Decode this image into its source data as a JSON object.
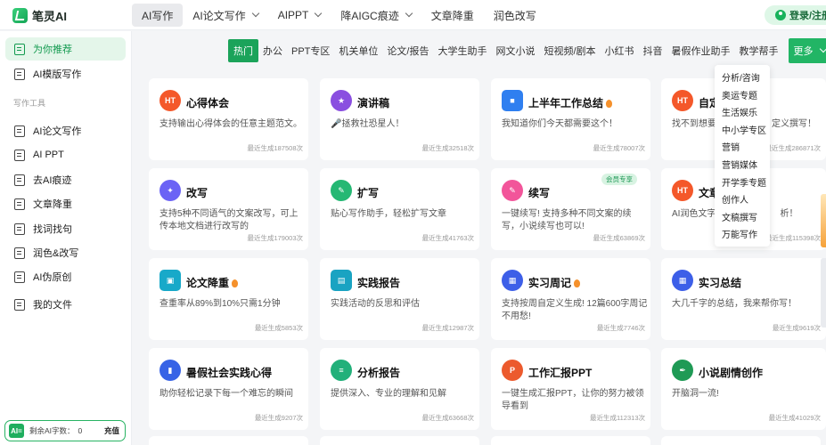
{
  "app": {
    "name": "笔灵AI"
  },
  "topnav": [
    {
      "label": "AI写作",
      "active": true,
      "dropdown": false
    },
    {
      "label": "AI论文写作",
      "active": false,
      "dropdown": true
    },
    {
      "label": "AIPPT",
      "active": false,
      "dropdown": true
    },
    {
      "label": "降AIGC痕迹",
      "active": false,
      "dropdown": true
    },
    {
      "label": "文章降重",
      "active": false,
      "dropdown": false
    },
    {
      "label": "润色改写",
      "active": false,
      "dropdown": false
    }
  ],
  "login": "登录/注册",
  "sidebar": {
    "items": [
      {
        "label": "为你推荐",
        "active": true
      },
      {
        "label": "AI模版写作",
        "active": false
      },
      {
        "label": "AI论文写作",
        "active": false
      },
      {
        "label": "AI PPT",
        "active": false
      },
      {
        "label": "去AI痕迹",
        "active": false
      },
      {
        "label": "文章降重",
        "active": false
      },
      {
        "label": "找词找句",
        "active": false
      },
      {
        "label": "润色&改写",
        "active": false
      },
      {
        "label": "AI伪原创",
        "active": false
      },
      {
        "label": "我的文件",
        "active": false
      }
    ],
    "section_label": "写作工具",
    "quota": {
      "badge": "AI=",
      "label": "剩余AI字数：",
      "value": "0",
      "button": "充值"
    }
  },
  "categories": [
    "热门",
    "办公",
    "PPT专区",
    "机关单位",
    "论文/报告",
    "大学生助手",
    "网文小说",
    "短视频/剧本",
    "小红书",
    "抖音",
    "暑假作业助手",
    "教学帮手"
  ],
  "more_label": "更多",
  "more_menu": [
    "分析/咨询",
    "奥运专题",
    "生活娱乐",
    "中小学专区",
    "营销",
    "营销媒体",
    "开学季专题",
    "创作人",
    "文稿撰写",
    "万能写作"
  ],
  "cards": [
    {
      "title": "心得体会",
      "desc": "支持输出心得体会的任意主题范文。",
      "count": "最近生成187508次",
      "icon": "fire-ht-icon",
      "color": "#f4582a",
      "flame": false,
      "vip": ""
    },
    {
      "title": "演讲稿",
      "desc": "🎤拯救社恐星人！",
      "count": "最近生成32518次",
      "icon": "star-icon",
      "color": "#8a4fe0",
      "flame": false,
      "vip": ""
    },
    {
      "title": "上半年工作总结",
      "desc": "我知道你们今天都需要这个！",
      "count": "最近生成78007次",
      "icon": "briefcase-icon",
      "color": "#2f7ff0",
      "flame": true,
      "vip": ""
    },
    {
      "title": "自定",
      "desc": "找不到想要",
      "desc_tail": "定义撰写！",
      "count": "最近生成286871次",
      "icon": "fire-ht-icon",
      "color": "#f4582a",
      "flame": false,
      "vip": ""
    },
    {
      "title": "改写",
      "desc": "支持5种不同语气的文案改写，可上传本地文档进行改写的",
      "count": "最近生成179003次",
      "icon": "magic-icon",
      "color": "#6b63f5",
      "flame": false,
      "vip": ""
    },
    {
      "title": "扩写",
      "desc": "贴心写作助手，轻松扩写文章",
      "count": "最近生成41763次",
      "icon": "expand-icon",
      "color": "#25b874",
      "flame": false,
      "vip": ""
    },
    {
      "title": "续写",
      "desc": "一键续写! 支持多种不同文案的续写，小说续写也可以!",
      "count": "最近生成63869次",
      "icon": "pen-icon",
      "color": "#f2559a",
      "flame": false,
      "vip": "会员专享"
    },
    {
      "title": "文章",
      "desc": "AI润色文字，",
      "desc_tail": "析！",
      "count": "最近生成115398次",
      "icon": "fire-ht-icon",
      "color": "#f4582a",
      "flame": false,
      "vip": ""
    },
    {
      "title": "论文降重",
      "desc": "查重率从89%到10%只需1分钟",
      "count": "最近生成5853次",
      "icon": "doc-check-icon",
      "color": "#18a9c9",
      "flame": true,
      "vip": ""
    },
    {
      "title": "实践报告",
      "desc": "实践活动的反思和评估",
      "count": "最近生成12987次",
      "icon": "report-icon",
      "color": "#1aa3c2",
      "flame": false,
      "vip": ""
    },
    {
      "title": "实习周记",
      "desc": "支持按周自定义生成! 12篇600字周记不用愁!",
      "count": "最近生成7746次",
      "icon": "calendar-icon",
      "color": "#3d5fe8",
      "flame": true,
      "vip": ""
    },
    {
      "title": "实习总结",
      "desc": "大几千字的总结，我来帮你写！",
      "count": "最近生成9619次",
      "icon": "calendar-icon",
      "color": "#3d5fe8",
      "flame": false,
      "vip": ""
    },
    {
      "title": "暑假社会实践心得",
      "desc": "助你轻松记录下每一个难忘的瞬间",
      "count": "最近生成9207次",
      "icon": "book-icon",
      "color": "#3763e6",
      "flame": false,
      "vip": ""
    },
    {
      "title": "分析报告",
      "desc": "提供深入、专业的理解和见解",
      "count": "最近生成63668次",
      "icon": "doc-icon",
      "color": "#22b07a",
      "flame": false,
      "vip": ""
    },
    {
      "title": "工作汇报PPT",
      "desc": "一键生成汇报PPT，让你的努力被领导看到",
      "count": "最近生成112313次",
      "icon": "ppt-icon",
      "color": "#ec5a2d",
      "flame": false,
      "vip": ""
    },
    {
      "title": "小说剧情创作",
      "desc": "开脑洞一流!",
      "count": "最近生成41029次",
      "icon": "quill-icon",
      "color": "#1f9a55",
      "flame": false,
      "vip": ""
    }
  ]
}
